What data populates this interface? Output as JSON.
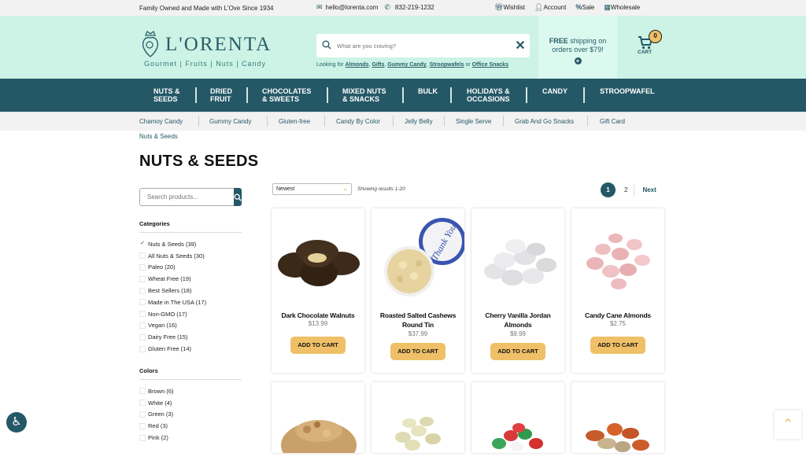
{
  "topbar": {
    "tagline": "Family Owned and Made with L'Ove Since 1934",
    "email": "hello@lorenta.com",
    "phone": "832-219-1232",
    "links": [
      {
        "label": "Wishlist",
        "icon": "gift-icon"
      },
      {
        "label": "Account",
        "icon": "user-icon"
      },
      {
        "label": "Sale",
        "icon": "percent-icon"
      },
      {
        "label": "Wholesale",
        "icon": "boxes-icon"
      }
    ]
  },
  "header": {
    "logo_name": "L'ORENTA",
    "logo_tagline": "Gourmet | Fruits | Nuts | Candy",
    "search_placeholder": "What are you craving?",
    "suggest_prefix": "Looking for",
    "suggestions": [
      "Almonds",
      "Gifts",
      "Gummy Candy",
      "Stroopwafels",
      "Office Snacks"
    ],
    "suggest_or": "or",
    "shipping_bold": "FREE",
    "shipping_text": "shipping on orders over $79!",
    "cart_label": "CART",
    "cart_count": "0"
  },
  "nav": [
    "NUTS &\nSEEDS",
    "DRIED\nFRUIT",
    "CHOCOLATES\n& SWEETS",
    "MIXED NUTS\n& SNACKS",
    "BULK",
    "HOLIDAYS &\nOCCASIONS",
    "CANDY",
    "STROOPWAFEL"
  ],
  "subnav": [
    "Chamoy Candy",
    "Gummy Candy",
    "Gluten-free",
    "Candy By Color",
    "Jelly Belly",
    "Single Serve",
    "Grab And Go Snacks",
    "Gift Card"
  ],
  "breadcrumb": "Nuts & Seeds",
  "page_title": "NUTS & SEEDS",
  "sidebar": {
    "search_placeholder": "Search products...",
    "categories_heading": "Categories",
    "categories": [
      {
        "label": "Nuts & Seeds (39)",
        "checked": true
      },
      {
        "label": "All Nuts & Seeds (30)",
        "checked": false
      },
      {
        "label": "Paleo (20)",
        "checked": false
      },
      {
        "label": "Wheat Free (19)",
        "checked": false
      },
      {
        "label": "Best Sellers (18)",
        "checked": false
      },
      {
        "label": "Made in The USA (17)",
        "checked": false
      },
      {
        "label": "Non-GMO (17)",
        "checked": false
      },
      {
        "label": "Vegan (16)",
        "checked": false
      },
      {
        "label": "Dairy Free (15)",
        "checked": false
      },
      {
        "label": "Gluten Free (14)",
        "checked": false
      }
    ],
    "colors_heading": "Colors",
    "colors": [
      {
        "label": "Brown (6)",
        "checked": false
      },
      {
        "label": "White (4)",
        "checked": false
      },
      {
        "label": "Green (3)",
        "checked": false
      },
      {
        "label": "Red (3)",
        "checked": false
      },
      {
        "label": "Pink (2)",
        "checked": false
      }
    ]
  },
  "toolbar": {
    "sort_value": "Newest",
    "showing": "Showing results 1-20",
    "pages": [
      "1",
      "2"
    ],
    "current_page": "1",
    "next_label": "Next"
  },
  "products": [
    {
      "name": "Dark Chocolate Walnuts",
      "price": "$13.99",
      "button": "ADD TO CART"
    },
    {
      "name": "Roasted Salted Cashews Round Tin",
      "price": "$37.99",
      "button": "ADD TO CART"
    },
    {
      "name": "Cherry Vanilla Jordan Almonds",
      "price": "$9.99",
      "button": "ADD TO CART"
    },
    {
      "name": "Candy Cane Almonds",
      "price": "$2.75",
      "button": "ADD TO CART"
    }
  ],
  "colors": {
    "brand_teal": "#245866",
    "header_mint": "#cdf3e6",
    "accent_gold": "#efc068"
  }
}
